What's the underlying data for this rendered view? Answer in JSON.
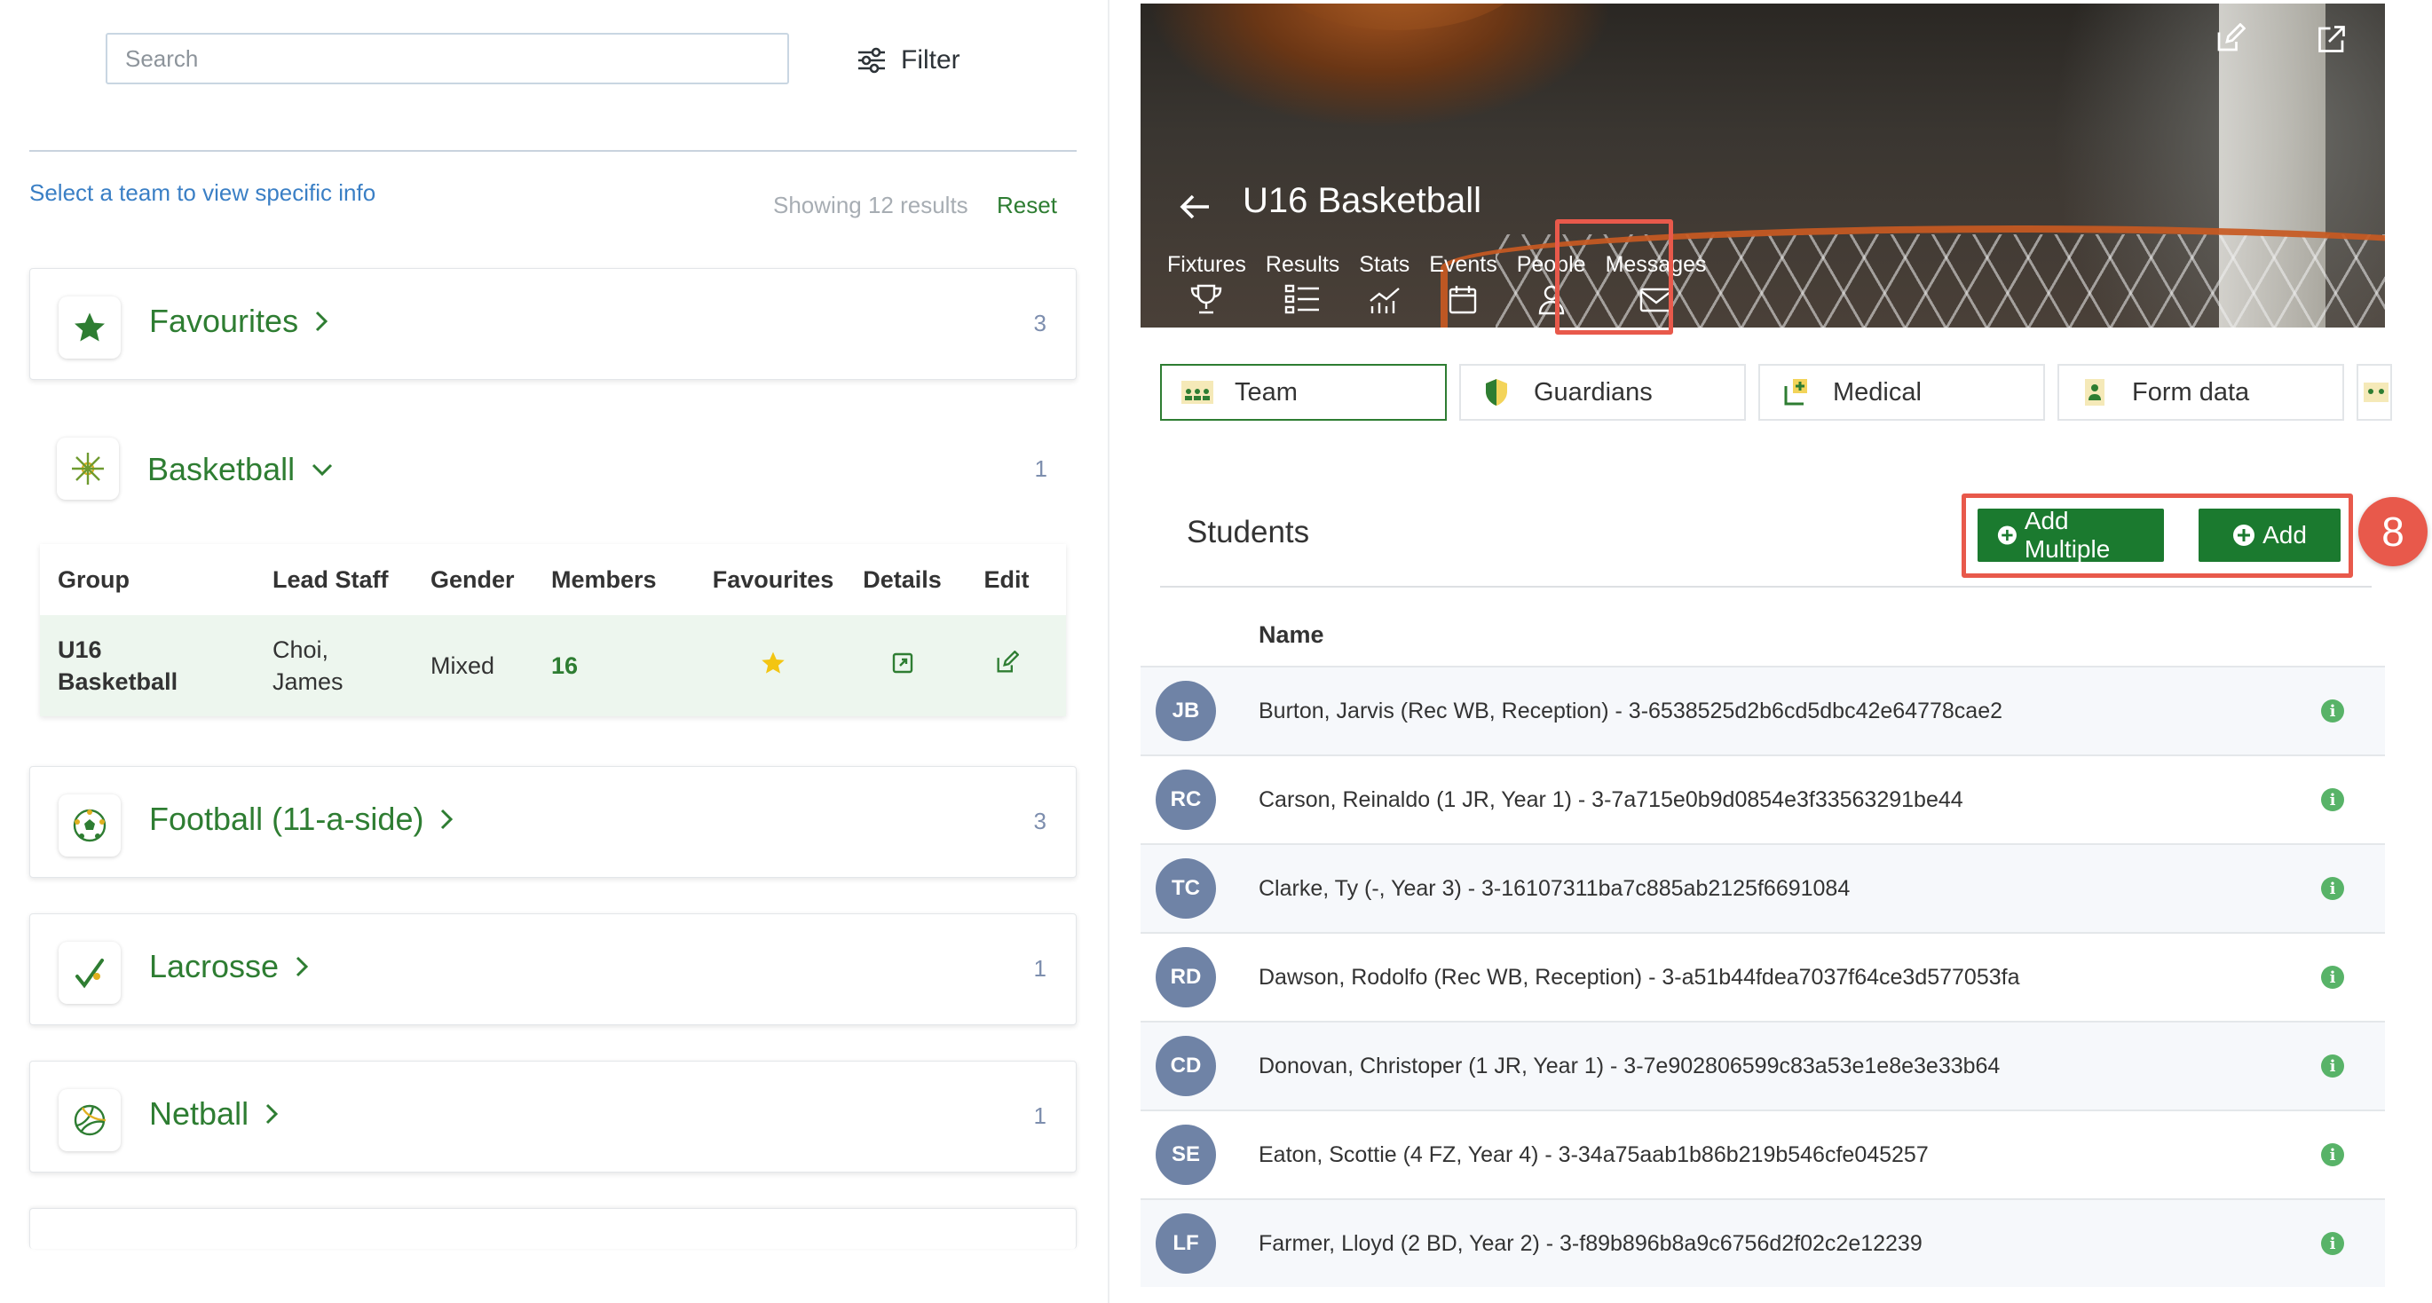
{
  "left": {
    "search_placeholder": "Search",
    "filter_label": "Filter",
    "hint": "Select a team to view specific info",
    "showing": "Showing 12 results",
    "reset": "Reset",
    "favourites": {
      "title": "Favourites",
      "count": "3"
    },
    "basketball": {
      "title": "Basketball",
      "count": "1"
    },
    "table": {
      "headers": [
        "Group",
        "Lead Staff",
        "Gender",
        "Members",
        "Favourites",
        "Details",
        "Edit"
      ],
      "row": {
        "group_line1": "U16",
        "group_line2": "Basketball",
        "lead_line1": "Choi,",
        "lead_line2": "James",
        "gender": "Mixed",
        "members": "16"
      }
    },
    "sports": [
      {
        "title": "Football (11-a-side)",
        "count": "3"
      },
      {
        "title": "Lacrosse",
        "count": "1"
      },
      {
        "title": "Netball",
        "count": "1"
      }
    ]
  },
  "right": {
    "team_title": "U16 Basketball",
    "nav_tabs": [
      "Fixtures",
      "Results",
      "Stats",
      "Events",
      "People",
      "Messages"
    ],
    "people_tabs": [
      "Team",
      "Guardians",
      "Medical",
      "Form data"
    ],
    "students_title": "Students",
    "add_multiple": "Add Multiple",
    "add": "Add",
    "step_badge": "8",
    "name_header": "Name",
    "students": [
      {
        "initials": "JB",
        "name": "Burton, Jarvis (Rec WB, Reception) - 3-6538525d2b6cd5dbc42e64778cae2"
      },
      {
        "initials": "RC",
        "name": "Carson, Reinaldo (1 JR, Year 1) - 3-7a715e0b9d0854e3f33563291be44"
      },
      {
        "initials": "TC",
        "name": "Clarke, Ty (-, Year 3) - 3-16107311ba7c885ab2125f6691084"
      },
      {
        "initials": "RD",
        "name": "Dawson, Rodolfo (Rec WB, Reception) - 3-a51b44fdea7037f64ce3d577053fa"
      },
      {
        "initials": "CD",
        "name": "Donovan, Christoper (1 JR, Year 1) - 3-7e902806599c83a53e1e8e3e33b64"
      },
      {
        "initials": "SE",
        "name": "Eaton, Scottie (4 FZ, Year 4) - 3-34a75aab1b86b219b546cfe045257"
      },
      {
        "initials": "LF",
        "name": "Farmer, Lloyd (2 BD, Year 2) - 3-f89b896b8a9c6756d2f02c2e12239"
      }
    ],
    "info_glyph": "i"
  },
  "colors": {
    "brand_green": "#2e7d32",
    "button_green": "#1b7a2f",
    "highlight_red": "#e8594b",
    "link_blue": "#3a7fc5",
    "avatar_slate": "#6f83a6"
  }
}
